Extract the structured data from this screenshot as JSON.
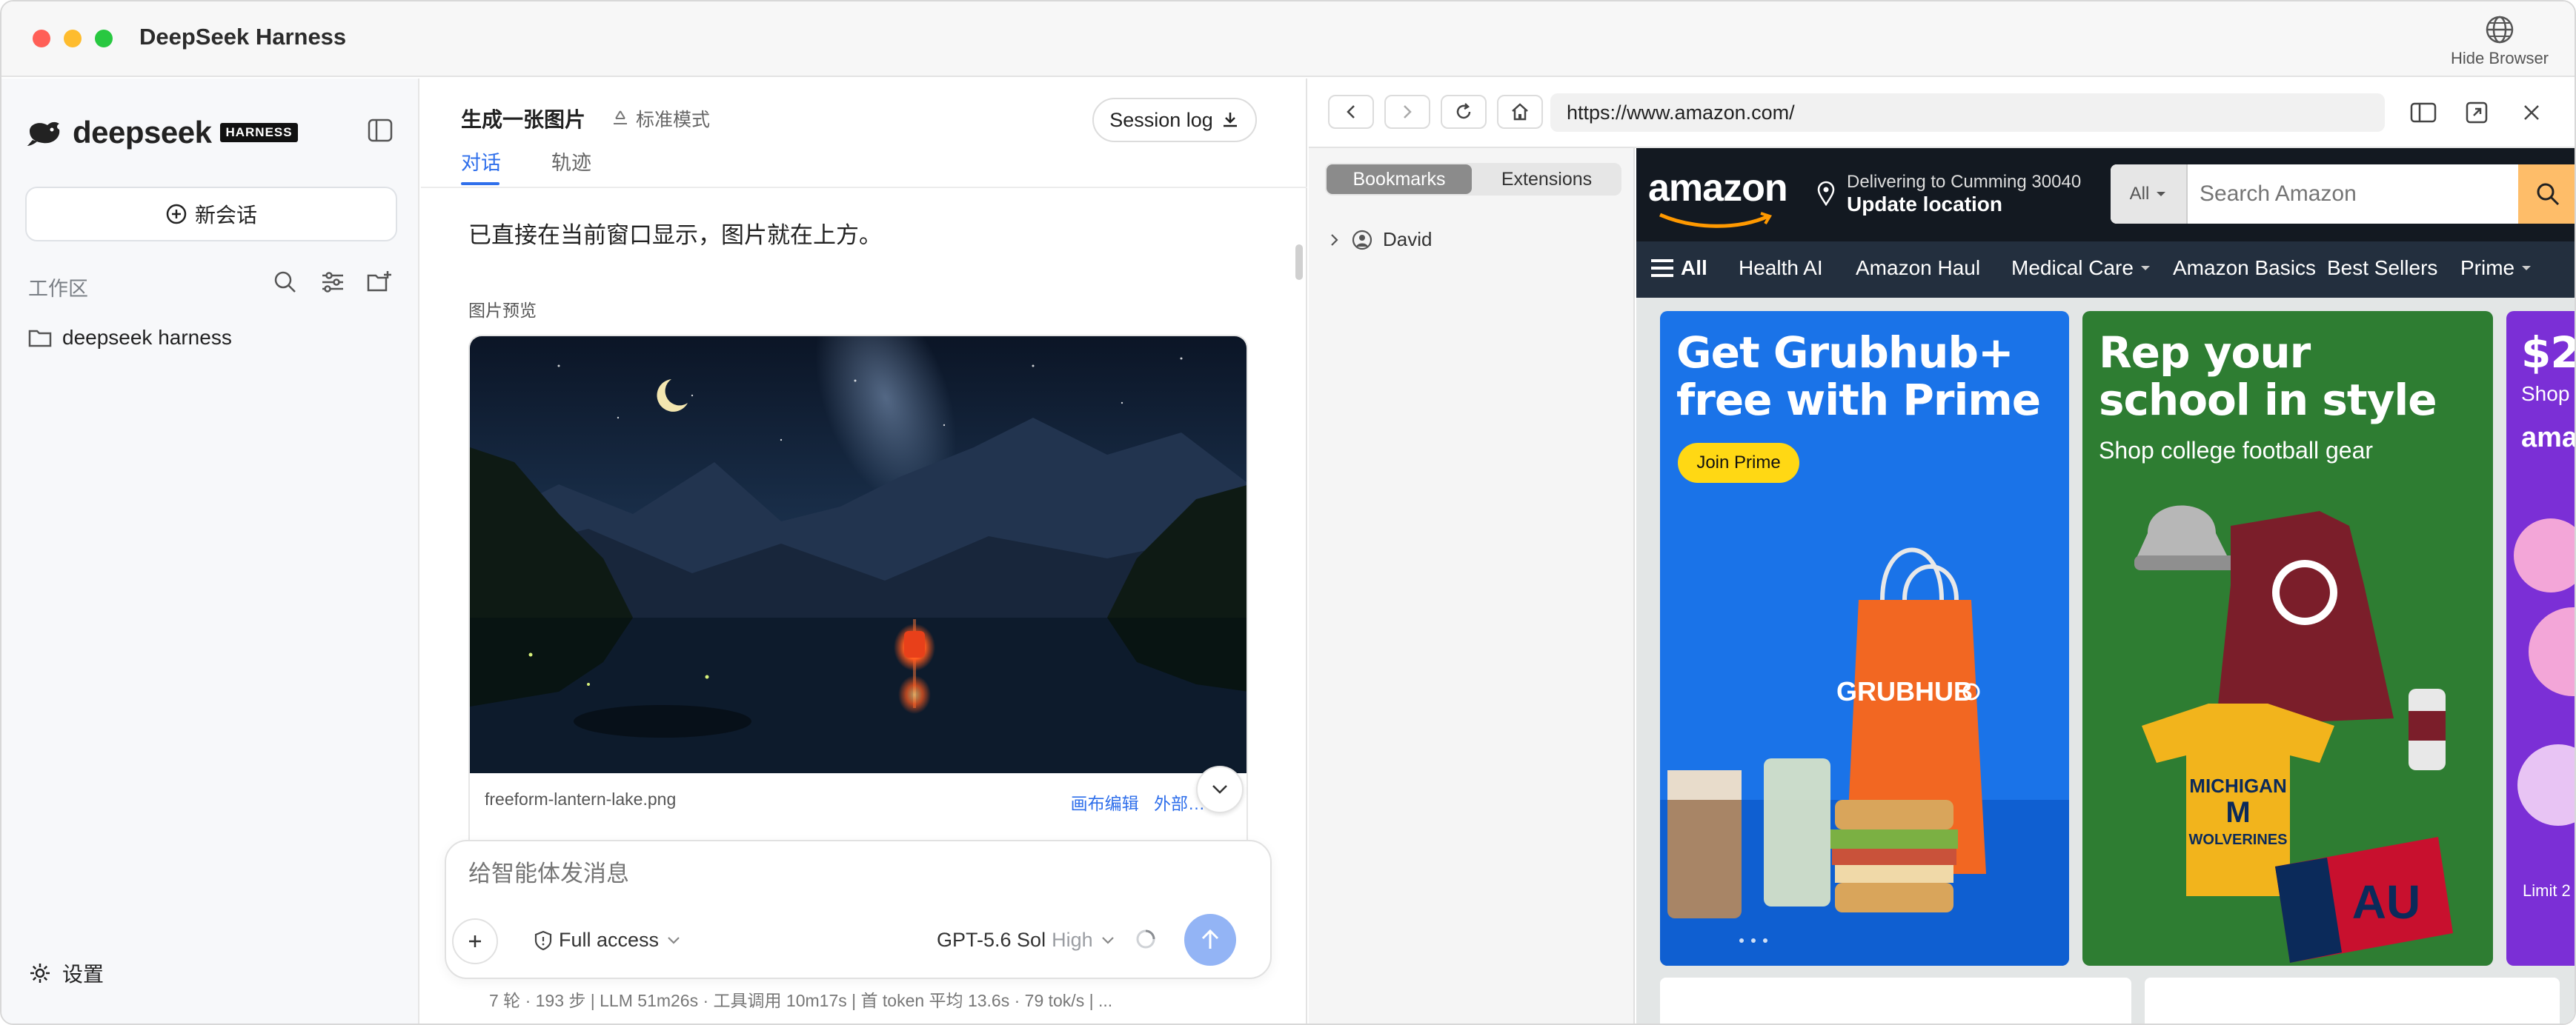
{
  "window": {
    "title": "DeepSeek Harness",
    "hide_browser_label": "Hide Browser"
  },
  "sidebar": {
    "logo_text": "deepseek",
    "logo_tag": "HARNESS",
    "new_chat_label": "新会话",
    "workspace_label": "工作区",
    "folders": [
      {
        "label": "deepseek harness"
      }
    ],
    "settings_label": "设置"
  },
  "chat": {
    "title": "生成一张图片",
    "mode_label": "标准模式",
    "session_log_label": "Session log",
    "tabs": [
      {
        "label": "对话"
      },
      {
        "label": "轨迹"
      }
    ],
    "message": "已直接在当前窗口显示，图片就在上方。",
    "preview_label": "图片预览",
    "image": {
      "filename": "freeform-lantern-lake.png",
      "edit_link": "画布编辑",
      "external_link": "外部…"
    },
    "composer": {
      "placeholder": "给智能体发消息",
      "access_label": "Full access",
      "model_label": "GPT-5.6 Sol",
      "model_level": "High"
    },
    "stats": "7 轮 · 193 步   |   LLM 51m26s · 工具调用 10m17s   |   首 token 平均 13.6s · 79 tok/s   |   ..."
  },
  "browser": {
    "url": "https://www.amazon.com/",
    "bookmarks_tab": "Bookmarks",
    "extensions_tab": "Extensions",
    "bookmark_items": [
      {
        "label": "David"
      }
    ]
  },
  "amazon": {
    "logo": "amazon",
    "deliver_line1": "Delivering to Cumming 30040",
    "deliver_line2": "Update location",
    "search_category": "All",
    "search_placeholder": "Search Amazon",
    "nav": [
      {
        "label": "All"
      },
      {
        "label": "Health AI"
      },
      {
        "label": "Amazon Haul"
      },
      {
        "label": "Medical Care"
      },
      {
        "label": "Amazon Basics"
      },
      {
        "label": "Best Sellers"
      },
      {
        "label": "Prime"
      }
    ],
    "promos": [
      {
        "title_l1": "Get Grubhub+",
        "title_l2": "free with Prime",
        "button": "Join Prime",
        "brand": "GRUBHUB"
      },
      {
        "title_l1": "Rep your",
        "title_l2": "school in style",
        "subtitle": "Shop college football gear",
        "shirt_l1": "MICHIGAN",
        "shirt_l2": "M",
        "shirt_l3": "WOLVERINES",
        "flag": "AU"
      },
      {
        "title_l1": "$2",
        "subtitle": "Shop",
        "brand": "ama",
        "footer": "Limit 2"
      }
    ]
  },
  "colors": {
    "accent": "#2f6feb",
    "amazon_dark": "#131921",
    "amazon_nav": "#232f3e",
    "grubhub_blue": "#1a73e8",
    "grubhub_orange": "#f26722",
    "football_green": "#2e7d32",
    "prime_purple": "#7b2fd6"
  }
}
